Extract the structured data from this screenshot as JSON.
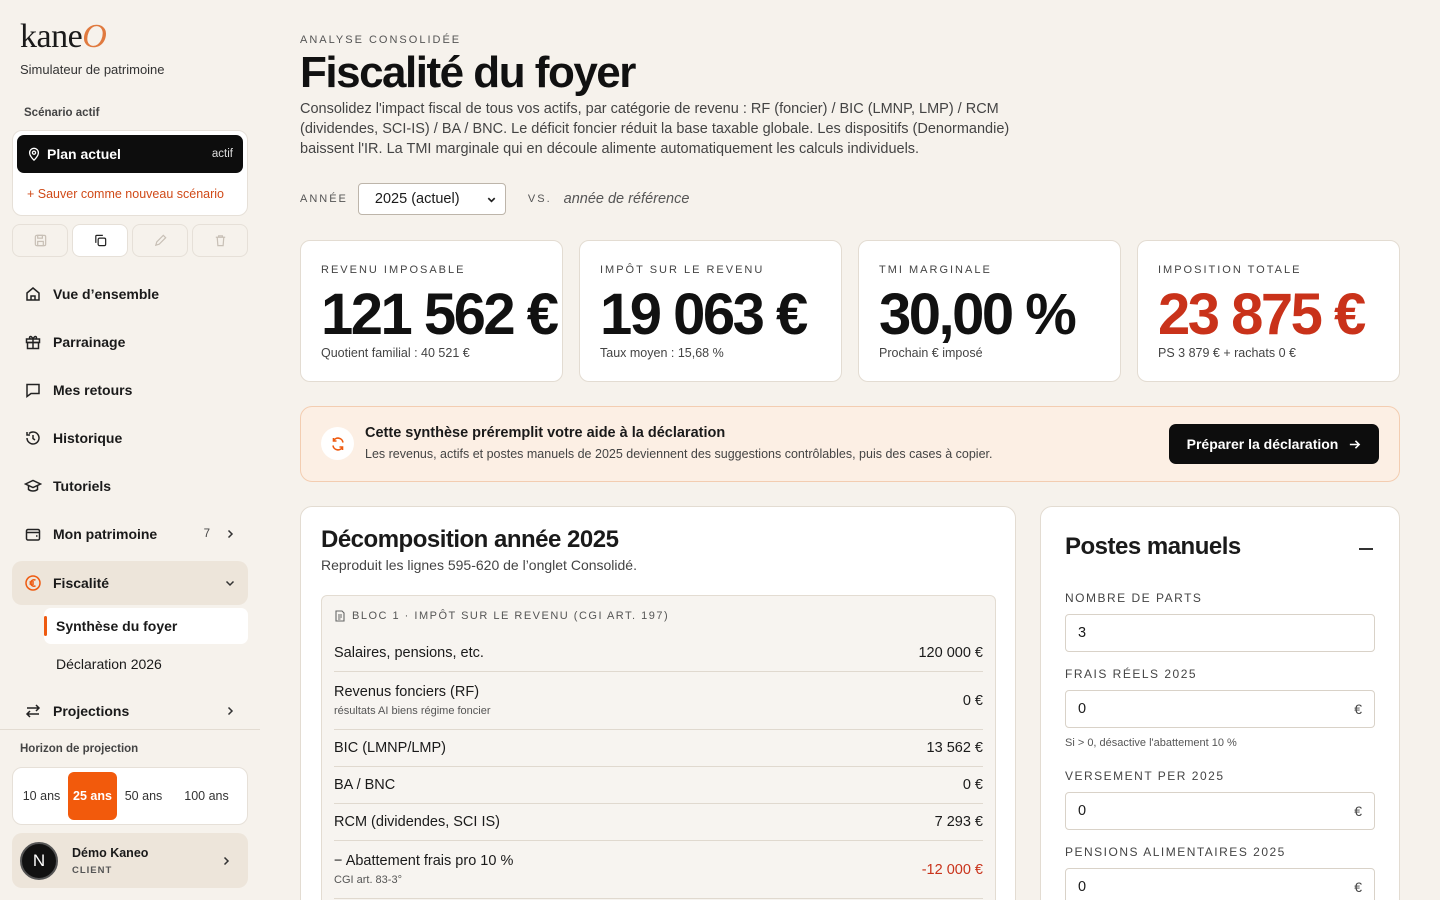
{
  "app": {
    "logo": "kane",
    "logo_accent": "O",
    "subtitle": "Simulateur de patrimoine"
  },
  "scenario": {
    "label": "Scénario actif",
    "active_name": "Plan actuel",
    "active_tag": "actif",
    "save_link": "+ Sauver comme nouveau scénario"
  },
  "nav": {
    "items": [
      {
        "label": "Vue d’ensemble",
        "icon": "home-icon"
      },
      {
        "label": "Parrainage",
        "icon": "gift-icon"
      },
      {
        "label": "Mes retours",
        "icon": "chat-icon"
      },
      {
        "label": "Historique",
        "icon": "history-icon"
      },
      {
        "label": "Tutoriels",
        "icon": "graduation-icon"
      },
      {
        "label": "Mon patrimoine",
        "icon": "wallet-icon",
        "count": "7"
      },
      {
        "label": "Fiscalité",
        "icon": "euro-icon"
      },
      {
        "label": "Projections",
        "icon": "arrows-icon"
      }
    ],
    "sub_items": [
      {
        "label": "Synthèse du foyer"
      },
      {
        "label": "Déclaration 2026"
      }
    ]
  },
  "horizon": {
    "label": "Horizon de projection",
    "options": [
      "10 ans",
      "25 ans",
      "50 ans",
      "100 ans"
    ],
    "selected": "25 ans"
  },
  "user": {
    "initial": "N",
    "name": "Démo Kaneo",
    "role": "CLIENT"
  },
  "page": {
    "eyebrow": "ANALYSE CONSOLIDÉE",
    "title": "Fiscalité du foyer",
    "description": "Consolidez l'impact fiscal de tous vos actifs, par catégorie de revenu : RF (foncier) / BIC (LMNP, LMP) / RCM (dividendes, SCI-IS) / BA / BNC. Le déficit foncier réduit la base taxable globale. Les dispositifs (Denormandie) baissent l'IR. La TMI marginale qui en découle alimente automatiquement les calculs individuels."
  },
  "year_filter": {
    "label": "ANNÉE",
    "selected": "2025 (actuel)",
    "vs_label": "VS.",
    "reference": "année de référence"
  },
  "kpis": [
    {
      "label": "REVENU IMPOSABLE",
      "value": "121 562 €",
      "sub": "Quotient familial : 40 521 €"
    },
    {
      "label": "IMPÔT SUR LE REVENU",
      "value": "19 063 €",
      "sub": "Taux moyen : 15,68 %"
    },
    {
      "label": "TMI MARGINALE",
      "value": "30,00 %",
      "sub": "Prochain € imposé"
    },
    {
      "label": "IMPOSITION TOTALE",
      "value": "23 875 €",
      "sub": "PS 3 879 € + rachats 0 €",
      "color": "#c9321a"
    }
  ],
  "banner": {
    "title": "Cette synthèse préremplit votre aide à la déclaration",
    "subtitle": "Les revenus, actifs et postes manuels de 2025 deviennent des suggestions contrôlables, puis des cases à copier.",
    "button": "Préparer la déclaration"
  },
  "decomposition": {
    "title": "Décomposition année 2025",
    "subtitle": "Reproduit les lignes 595-620 de l’onglet Consolidé.",
    "bloc_title": "BLOC 1 · IMPÔT SUR LE REVENU (CGI ART. 197)",
    "rows": [
      {
        "label": "Salaires, pensions, etc.",
        "note": "",
        "value": "120 000 €"
      },
      {
        "label": "Revenus fonciers (RF)",
        "note": "résultats AI biens régime foncier",
        "value": "0 €"
      },
      {
        "label": "BIC (LMNP/LMP)",
        "note": "",
        "value": "13 562 €"
      },
      {
        "label": "BA / BNC",
        "note": "",
        "value": "0 €"
      },
      {
        "label": "RCM (dividendes, SCI IS)",
        "note": "",
        "value": "7 293 €"
      },
      {
        "label": "− Abattement frais pro 10 %",
        "note": "CGI art. 83-3°",
        "value": "-12 000 €",
        "negative": true
      }
    ]
  },
  "manual": {
    "title": "Postes manuels",
    "fields": [
      {
        "label": "NOMBRE DE PARTS",
        "value": "3",
        "unit": ""
      },
      {
        "label": "FRAIS RÉELS 2025",
        "value": "0",
        "unit": "€"
      },
      {
        "label": "VERSEMENT PER 2025",
        "value": "0",
        "unit": "€"
      },
      {
        "label": "PENSIONS ALIMENTAIRES 2025",
        "value": "0",
        "unit": "€"
      }
    ],
    "hint": "Si > 0, désactive l'abattement 10 %"
  }
}
